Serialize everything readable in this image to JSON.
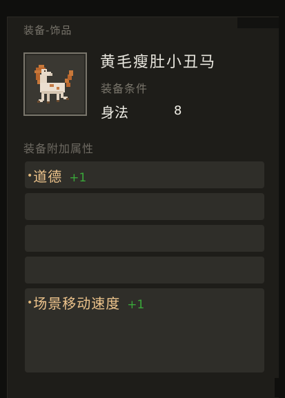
{
  "tooltip": {
    "category": "装备-饰品",
    "item_name": "黄毛瘦肚小丑马",
    "icon": "horse-icon",
    "requirements_label": "装备条件",
    "requirement": {
      "name": "身法",
      "value": "8"
    },
    "attributes_header": "装备附加属性",
    "attributes": [
      {
        "bullet": "•",
        "name": "道德",
        "bonus": "+1"
      },
      {
        "bullet": "•",
        "name": "场景移动速度",
        "bonus": "+1"
      }
    ]
  },
  "colors": {
    "attribute_name": "#eec48c",
    "bonus": "#3aa83a",
    "slot_bg": "#2f2e29",
    "panel_bg": "#1e1d19"
  }
}
